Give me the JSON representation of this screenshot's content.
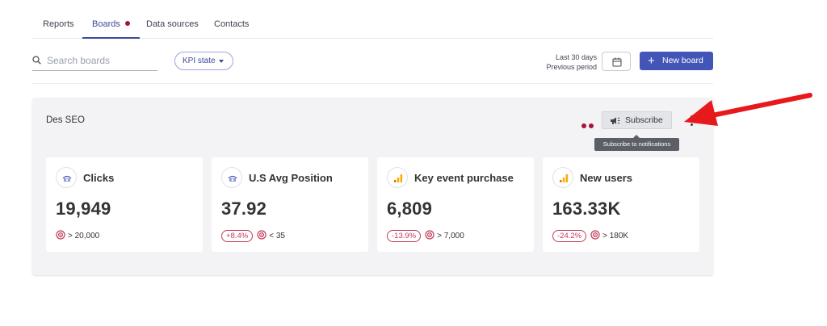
{
  "tabs": [
    {
      "label": "Reports",
      "active": false
    },
    {
      "label": "Boards",
      "active": true,
      "dot": true
    },
    {
      "label": "Data sources",
      "active": false
    },
    {
      "label": "Contacts",
      "active": false
    }
  ],
  "toolbar": {
    "search_placeholder": "Search boards",
    "kpi_state_label": "KPI state",
    "period_line1": "Last 30 days",
    "period_line2": "Previous period",
    "new_board_label": "New board"
  },
  "board": {
    "title": "Des SEO",
    "subscribe_label": "Subscribe",
    "tooltip": "Subscribe to notifications",
    "cards": [
      {
        "title": "Clicks",
        "icon": "search-console-icon",
        "value": "19,949",
        "delta": "",
        "target": "> 20,000"
      },
      {
        "title": "U.S Avg Position",
        "icon": "search-console-icon",
        "value": "37.92",
        "delta": "+8.4%",
        "target": "< 35"
      },
      {
        "title": "Key event purchase",
        "icon": "analytics-icon",
        "value": "6,809",
        "delta": "-13.9%",
        "target": "> 7,000"
      },
      {
        "title": "New users",
        "icon": "analytics-icon",
        "value": "163.33K",
        "delta": "-24.2%",
        "target": "> 180K"
      }
    ]
  },
  "colors": {
    "accent": "#4455b8",
    "alert": "#a3173f",
    "delta": "#c23a5a",
    "annotation_arrow": "#e8191c"
  }
}
